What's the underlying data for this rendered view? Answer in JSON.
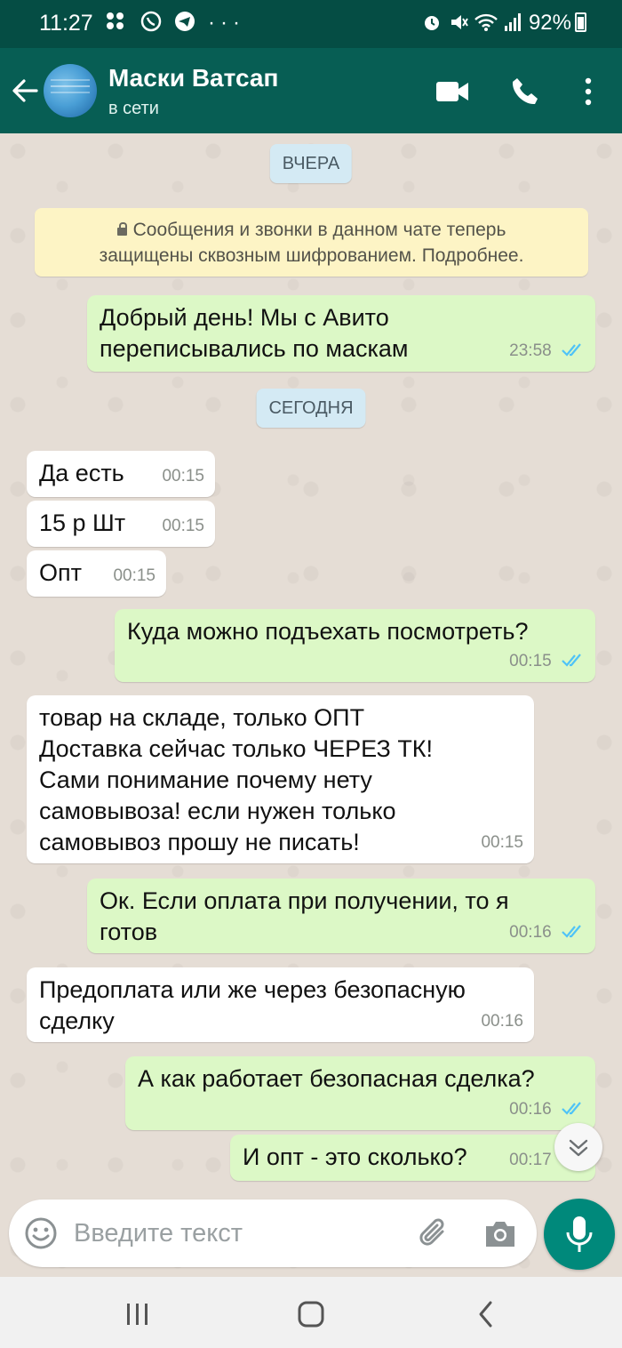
{
  "status_bar": {
    "time": "11:27",
    "icons": [
      "blackberry-icon",
      "whatsapp-icon",
      "telegram-icon",
      "more-dots-icon"
    ],
    "more_dots": "···",
    "battery": "92%"
  },
  "header": {
    "title": "Маски Ватсап",
    "subtitle": "в сети",
    "icons": [
      "back-arrow-icon",
      "video-call-icon",
      "phone-icon",
      "menu-dots-icon"
    ]
  },
  "chat": {
    "date_yesterday": "ВЧЕРА",
    "date_today": "СЕГОДНЯ",
    "encryption_notice": [
      "Сообщения и звонки в данном чате теперь",
      "защищены сквозным шифрованием. Подробнее."
    ],
    "messages": [
      {
        "dir": "out",
        "text": "Добрый день! Мы с Авито\nпереписывались по маскам",
        "time": "23:58",
        "read": true
      },
      {
        "dir": "in",
        "text": "Да есть",
        "time": "00:15"
      },
      {
        "dir": "in",
        "text": "15 р Шт",
        "time": "00:15"
      },
      {
        "dir": "in",
        "text": "Опт",
        "time": "00:15"
      },
      {
        "dir": "out",
        "text": "Куда можно подъехать посмотреть?",
        "time": "00:15",
        "read": true
      },
      {
        "dir": "in",
        "text": "товар на складе, только ОПТ\nДоставка сейчас только ЧЕРЕЗ ТК!\nСами понимание почему нету\nсамовывоза! если нужен только\nсамовывоз прошу не писать!",
        "time": "00:15"
      },
      {
        "dir": "out",
        "text": "Ок. Если оплата при получении, то я\nготов",
        "time": "00:16",
        "read": true
      },
      {
        "dir": "in",
        "text": "Предоплата или же через безопасную\nсделку",
        "time": "00:16"
      },
      {
        "dir": "out",
        "text": "А как работает безопасная сделка?",
        "time": "00:16",
        "read": true
      },
      {
        "dir": "out",
        "text": "И опт - это сколько?",
        "time": "00:17",
        "read": true
      }
    ]
  },
  "composer": {
    "placeholder": "Введите текст",
    "icons": [
      "emoji-icon",
      "attach-icon",
      "camera-icon",
      "mic-icon"
    ]
  },
  "colors": {
    "status_bar": "#054d44",
    "header": "#075e54",
    "outgoing_bubble": "#dcf8c6",
    "incoming_bubble": "#ffffff",
    "read_ticks": "#4fc3f7",
    "mic_button": "#00897b"
  }
}
